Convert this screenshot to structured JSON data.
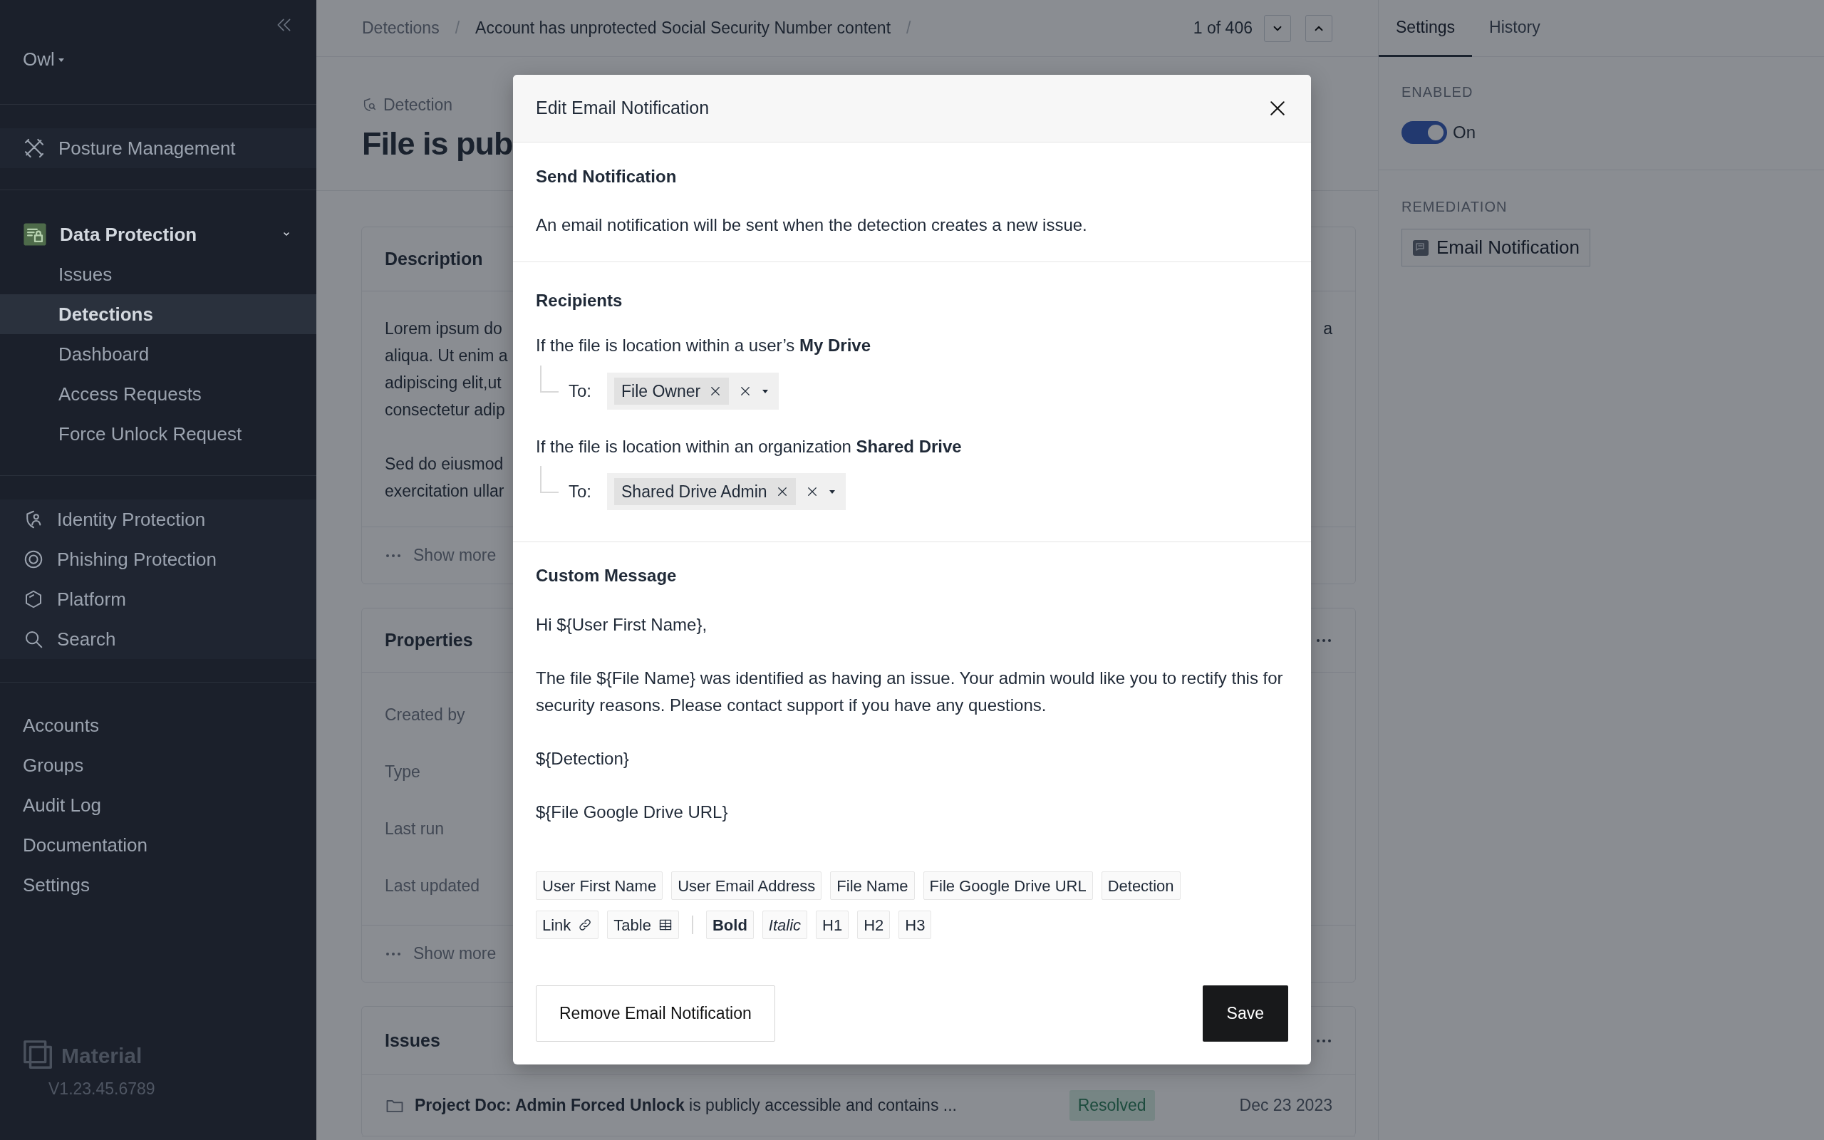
{
  "sidebar": {
    "workspace": "Owl",
    "products": [
      {
        "label": "Posture Management"
      }
    ],
    "current_product": {
      "label": "Data Protection",
      "expanded": true,
      "children": [
        {
          "label": "Issues",
          "selected": false
        },
        {
          "label": "Detections",
          "selected": true
        },
        {
          "label": "Dashboard",
          "selected": false
        },
        {
          "label": "Access Requests",
          "selected": false
        },
        {
          "label": "Force Unlock Request",
          "selected": false
        }
      ]
    },
    "other_products": [
      {
        "label": "Identity Protection"
      },
      {
        "label": "Phishing Protection"
      },
      {
        "label": "Platform"
      },
      {
        "label": "Search"
      }
    ],
    "links": [
      {
        "label": "Accounts"
      },
      {
        "label": "Groups"
      },
      {
        "label": "Audit Log"
      },
      {
        "label": "Documentation"
      },
      {
        "label": "Settings"
      }
    ],
    "brand": "Material",
    "version": "V1.23.45.6789"
  },
  "breadcrumbs": [
    {
      "label": "Detections",
      "separator": "/"
    },
    {
      "label": "Account has unprotected Social Security Number content",
      "separator": "/"
    }
  ],
  "pager": {
    "text": "1 of 406"
  },
  "detection": {
    "eyebrow": "Detection",
    "title": "File is pub"
  },
  "description": {
    "title": "Description",
    "paragraphs": [
      [
        {
          "text": "Lorem ipsum do",
          "tail": "a"
        },
        {
          "text": "aliqua. Ut enim a"
        },
        {
          "text": "adipiscing elit,ut"
        },
        {
          "text": "consectetur adip"
        }
      ],
      [
        {
          "text": "Sed do eiusmod"
        },
        {
          "text": "exercitation ullar"
        }
      ]
    ],
    "show_more": "Show more"
  },
  "properties": {
    "title": "Properties",
    "rows": [
      "Created by",
      "Type",
      "Last run",
      "Last updated"
    ],
    "show_more": "Show more"
  },
  "issues": {
    "title": "Issues",
    "rows": [
      {
        "text": "**Project Doc: Admin Forced Unlock** is publicly accessible and contains ...",
        "status": "Resolved",
        "date": "Dec 23 2023"
      }
    ]
  },
  "settings_panel": {
    "tabs": [
      {
        "label": "Settings",
        "selected": true
      },
      {
        "label": "History",
        "selected": false
      }
    ],
    "enabled": {
      "label": "ENABLED",
      "on": true,
      "state_text": "On"
    },
    "remediation": {
      "label": "REMEDIATION",
      "button": "Email Notification"
    }
  },
  "modal": {
    "title": "Edit Email Notification",
    "send": {
      "title": "Send Notification",
      "text": "An email notification will be sent when the detection creates a new issue."
    },
    "recipients": {
      "title": "Recipients",
      "rules": [
        {
          "condition": "If the file is location within a user’s **My Drive**",
          "to_label": "To:",
          "chips": [
            "File Owner"
          ]
        },
        {
          "condition": "If the file is location within an organization **Shared Drive**",
          "to_label": "To:",
          "chips": [
            "Shared Drive Admin"
          ]
        }
      ]
    },
    "message": {
      "title": "Custom Message",
      "paragraphs": [
        "Hi ${User First Name},",
        "The file ${File Name} was identified as having an issue. Your admin would like you to rectify this for security reasons. Please contact support if you have any questions.",
        "${Detection}",
        "${File Google Drive URL}"
      ],
      "variables": [
        "User First Name",
        "User Email Address",
        "File Name",
        "File Google Drive URL",
        "Detection"
      ],
      "insert_tools": [
        {
          "label": "Link",
          "kind": "link"
        },
        {
          "label": "Table",
          "kind": "table"
        }
      ],
      "format_tools": [
        {
          "label": "Bold",
          "kind": "bold"
        },
        {
          "label": "Italic",
          "kind": "italic"
        },
        {
          "label": "H1",
          "kind": "plain"
        },
        {
          "label": "H2",
          "kind": "plain"
        },
        {
          "label": "H3",
          "kind": "plain"
        }
      ]
    },
    "buttons": {
      "remove": "Remove Email Notification",
      "save": "Save"
    }
  }
}
